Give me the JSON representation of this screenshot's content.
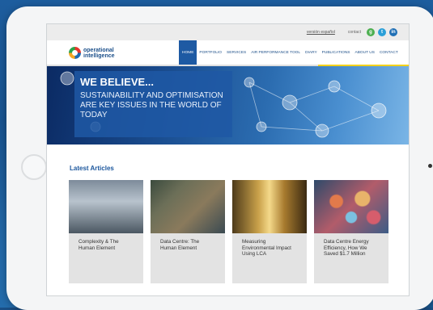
{
  "topbar": {
    "language_link": "versión español",
    "contact_label": "contact",
    "social": [
      {
        "icon": "google-plus-icon",
        "glyph": "g",
        "color": "#4caf50"
      },
      {
        "icon": "twitter-icon",
        "glyph": "t",
        "color": "#2a9fd8"
      },
      {
        "icon": "linkedin-icon",
        "glyph": "in",
        "color": "#1f6fb5"
      }
    ]
  },
  "header": {
    "logo_line1": "operational",
    "logo_line2": "intelligence",
    "nav": [
      "HOME",
      "PORTFOLIO",
      "SERVICES",
      "AIR PERFORMANCE TOOL",
      "DIARY",
      "PUBLICATIONS",
      "ABOUT US",
      "CONTACT"
    ],
    "active": "HOME"
  },
  "hero": {
    "title": "WE BELIEVE...",
    "body": "SUSTAINABILITY AND OPTIMISATION ARE KEY ISSUES IN THE WORLD OF TODAY"
  },
  "articles": {
    "heading": "Latest Articles",
    "items": [
      {
        "title": "Complexity & The Human Element"
      },
      {
        "title": "Data Centre: The Human Element"
      },
      {
        "title": "Measuring Environmental Impact Using LCA"
      },
      {
        "title": "Data Centre Energy Efficiency, How We Saved $1.7 Million"
      }
    ]
  },
  "colors": {
    "brand_blue": "#1e5aa3",
    "accent_yellow": "#f3d11b"
  }
}
